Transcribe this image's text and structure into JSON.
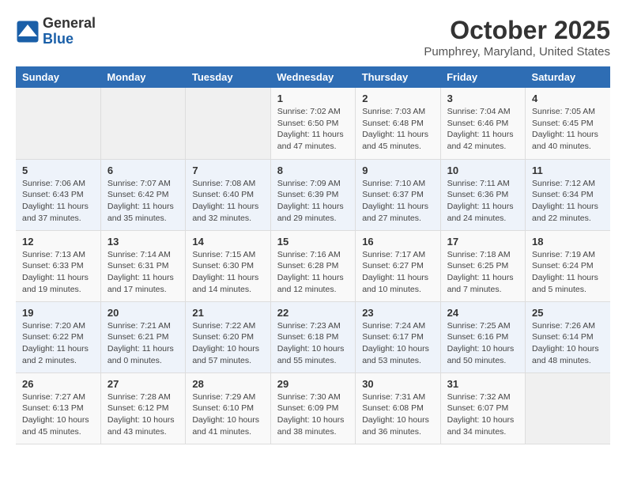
{
  "header": {
    "logo_general": "General",
    "logo_blue": "Blue",
    "month_year": "October 2025",
    "location": "Pumphrey, Maryland, United States"
  },
  "weekdays": [
    "Sunday",
    "Monday",
    "Tuesday",
    "Wednesday",
    "Thursday",
    "Friday",
    "Saturday"
  ],
  "weeks": [
    [
      {
        "day": "",
        "info": ""
      },
      {
        "day": "",
        "info": ""
      },
      {
        "day": "",
        "info": ""
      },
      {
        "day": "1",
        "info": "Sunrise: 7:02 AM\nSunset: 6:50 PM\nDaylight: 11 hours\nand 47 minutes."
      },
      {
        "day": "2",
        "info": "Sunrise: 7:03 AM\nSunset: 6:48 PM\nDaylight: 11 hours\nand 45 minutes."
      },
      {
        "day": "3",
        "info": "Sunrise: 7:04 AM\nSunset: 6:46 PM\nDaylight: 11 hours\nand 42 minutes."
      },
      {
        "day": "4",
        "info": "Sunrise: 7:05 AM\nSunset: 6:45 PM\nDaylight: 11 hours\nand 40 minutes."
      }
    ],
    [
      {
        "day": "5",
        "info": "Sunrise: 7:06 AM\nSunset: 6:43 PM\nDaylight: 11 hours\nand 37 minutes."
      },
      {
        "day": "6",
        "info": "Sunrise: 7:07 AM\nSunset: 6:42 PM\nDaylight: 11 hours\nand 35 minutes."
      },
      {
        "day": "7",
        "info": "Sunrise: 7:08 AM\nSunset: 6:40 PM\nDaylight: 11 hours\nand 32 minutes."
      },
      {
        "day": "8",
        "info": "Sunrise: 7:09 AM\nSunset: 6:39 PM\nDaylight: 11 hours\nand 29 minutes."
      },
      {
        "day": "9",
        "info": "Sunrise: 7:10 AM\nSunset: 6:37 PM\nDaylight: 11 hours\nand 27 minutes."
      },
      {
        "day": "10",
        "info": "Sunrise: 7:11 AM\nSunset: 6:36 PM\nDaylight: 11 hours\nand 24 minutes."
      },
      {
        "day": "11",
        "info": "Sunrise: 7:12 AM\nSunset: 6:34 PM\nDaylight: 11 hours\nand 22 minutes."
      }
    ],
    [
      {
        "day": "12",
        "info": "Sunrise: 7:13 AM\nSunset: 6:33 PM\nDaylight: 11 hours\nand 19 minutes."
      },
      {
        "day": "13",
        "info": "Sunrise: 7:14 AM\nSunset: 6:31 PM\nDaylight: 11 hours\nand 17 minutes."
      },
      {
        "day": "14",
        "info": "Sunrise: 7:15 AM\nSunset: 6:30 PM\nDaylight: 11 hours\nand 14 minutes."
      },
      {
        "day": "15",
        "info": "Sunrise: 7:16 AM\nSunset: 6:28 PM\nDaylight: 11 hours\nand 12 minutes."
      },
      {
        "day": "16",
        "info": "Sunrise: 7:17 AM\nSunset: 6:27 PM\nDaylight: 11 hours\nand 10 minutes."
      },
      {
        "day": "17",
        "info": "Sunrise: 7:18 AM\nSunset: 6:25 PM\nDaylight: 11 hours\nand 7 minutes."
      },
      {
        "day": "18",
        "info": "Sunrise: 7:19 AM\nSunset: 6:24 PM\nDaylight: 11 hours\nand 5 minutes."
      }
    ],
    [
      {
        "day": "19",
        "info": "Sunrise: 7:20 AM\nSunset: 6:22 PM\nDaylight: 11 hours\nand 2 minutes."
      },
      {
        "day": "20",
        "info": "Sunrise: 7:21 AM\nSunset: 6:21 PM\nDaylight: 11 hours\nand 0 minutes."
      },
      {
        "day": "21",
        "info": "Sunrise: 7:22 AM\nSunset: 6:20 PM\nDaylight: 10 hours\nand 57 minutes."
      },
      {
        "day": "22",
        "info": "Sunrise: 7:23 AM\nSunset: 6:18 PM\nDaylight: 10 hours\nand 55 minutes."
      },
      {
        "day": "23",
        "info": "Sunrise: 7:24 AM\nSunset: 6:17 PM\nDaylight: 10 hours\nand 53 minutes."
      },
      {
        "day": "24",
        "info": "Sunrise: 7:25 AM\nSunset: 6:16 PM\nDaylight: 10 hours\nand 50 minutes."
      },
      {
        "day": "25",
        "info": "Sunrise: 7:26 AM\nSunset: 6:14 PM\nDaylight: 10 hours\nand 48 minutes."
      }
    ],
    [
      {
        "day": "26",
        "info": "Sunrise: 7:27 AM\nSunset: 6:13 PM\nDaylight: 10 hours\nand 45 minutes."
      },
      {
        "day": "27",
        "info": "Sunrise: 7:28 AM\nSunset: 6:12 PM\nDaylight: 10 hours\nand 43 minutes."
      },
      {
        "day": "28",
        "info": "Sunrise: 7:29 AM\nSunset: 6:10 PM\nDaylight: 10 hours\nand 41 minutes."
      },
      {
        "day": "29",
        "info": "Sunrise: 7:30 AM\nSunset: 6:09 PM\nDaylight: 10 hours\nand 38 minutes."
      },
      {
        "day": "30",
        "info": "Sunrise: 7:31 AM\nSunset: 6:08 PM\nDaylight: 10 hours\nand 36 minutes."
      },
      {
        "day": "31",
        "info": "Sunrise: 7:32 AM\nSunset: 6:07 PM\nDaylight: 10 hours\nand 34 minutes."
      },
      {
        "day": "",
        "info": ""
      }
    ]
  ]
}
